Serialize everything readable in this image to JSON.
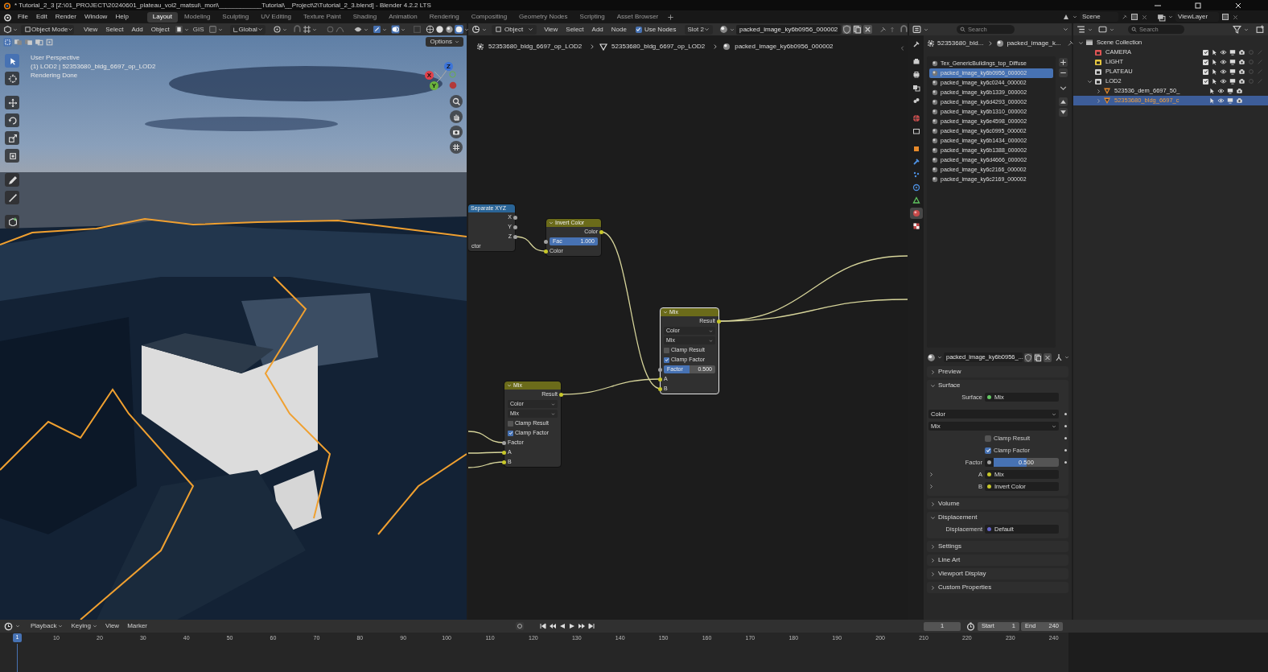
{
  "window": {
    "title": "* Tutorial_2_3 [Z:\\01_PROJECT\\20240601_plateau_vol2_matsui\\_mori\\____________Tutorial\\__Project\\2\\Tutorial_2_3.blend] - Blender 4.2.2 LTS"
  },
  "menu": [
    "File",
    "Edit",
    "Render",
    "Window",
    "Help"
  ],
  "workspaces": [
    {
      "label": "Layout",
      "selected": true
    },
    {
      "label": "Modeling",
      "selected": false
    },
    {
      "label": "Sculpting",
      "selected": false
    },
    {
      "label": "UV Editing",
      "selected": false
    },
    {
      "label": "Texture Paint",
      "selected": false
    },
    {
      "label": "Shading",
      "selected": false
    },
    {
      "label": "Animation",
      "selected": false
    },
    {
      "label": "Rendering",
      "selected": false
    },
    {
      "label": "Compositing",
      "selected": false
    },
    {
      "label": "Geometry Nodes",
      "selected": false
    },
    {
      "label": "Scripting",
      "selected": false
    },
    {
      "label": "Asset Browser",
      "selected": false
    }
  ],
  "scene": "Scene",
  "view_layer": "ViewLayer",
  "viewport": {
    "mode": "Object Mode",
    "menus": [
      "View",
      "Select",
      "Add",
      "Object"
    ],
    "gis": "GIS",
    "orientation": "Global",
    "options": "Options",
    "overlay": [
      "User Perspective",
      "(1) LOD2 | 52353680_bldg_6697_op_LOD2",
      "Rendering Done"
    ],
    "tools": [
      {
        "selected": true
      },
      {
        "selected": false
      },
      {
        "selected": false
      },
      {
        "selected": false
      },
      {
        "selected": false
      },
      {
        "selected": false
      },
      {
        "selected": false
      },
      {
        "selected": false
      },
      {
        "selected": false
      }
    ],
    "gizmo": [
      "Z",
      "X",
      "Y"
    ]
  },
  "node_editor": {
    "type": "Object",
    "menus": [
      "View",
      "Select",
      "Add",
      "Node"
    ],
    "use_nodes": {
      "label": "Use Nodes",
      "checked": true
    },
    "slot": "Slot 2",
    "material": "packed_image_ky6b0956_000002",
    "breadcrumbs": [
      "52353680_bldg_6697_op_LOD2",
      "52353680_bldg_6697_op_LOD2",
      "packed_image_ky6b0956_000002"
    ],
    "nodes": [
      {
        "title": "Separate XYZ",
        "color": "#2a6496",
        "selected": false,
        "rows": [
          {
            "kind": "output",
            "label": "X",
            "color": "#a1a1a1"
          },
          {
            "kind": "output",
            "label": "Y",
            "color": "#a1a1a1"
          },
          {
            "kind": "output",
            "label": "Z",
            "color": "#a1a1a1"
          },
          {
            "kind": "input",
            "label": "ctor"
          }
        ]
      },
      {
        "title": "Invert Color",
        "color": "#6b6b1a",
        "selected": false,
        "rows": [
          {
            "kind": "output",
            "label": "Color",
            "color": "#c7c729"
          },
          {
            "kind": "slider",
            "label": "Fac",
            "value": "1.000",
            "level": 1,
            "color": "#a1a1a1"
          },
          {
            "kind": "input",
            "label": "Color",
            "color": "#c7c729"
          }
        ]
      },
      {
        "title": "Mix",
        "color": "#6b6b1a",
        "selected": true,
        "rows": [
          {
            "kind": "output",
            "label": "Result",
            "color": "#c7c729"
          },
          {
            "kind": "dropdown",
            "label": "Color"
          },
          {
            "kind": "dropdown",
            "label": "Mix"
          },
          {
            "kind": "checkbox",
            "label": "Clamp Result",
            "checked": false
          },
          {
            "kind": "checkbox",
            "label": "Clamp Factor",
            "checked": true
          },
          {
            "kind": "slider",
            "label": "Factor",
            "value": "0.500",
            "level": 0.5,
            "color": "#a1a1a1"
          },
          {
            "kind": "input",
            "label": "A",
            "color": "#c7c729"
          },
          {
            "kind": "input",
            "label": "B",
            "color": "#c7c729"
          }
        ]
      },
      {
        "title": "Mix",
        "color": "#6b6b1a",
        "selected": false,
        "rows": [
          {
            "kind": "output",
            "label": "Result",
            "color": "#c7c729"
          },
          {
            "kind": "dropdown",
            "label": "Color"
          },
          {
            "kind": "dropdown",
            "label": "Mix"
          },
          {
            "kind": "checkbox",
            "label": "Clamp Result",
            "checked": false
          },
          {
            "kind": "checkbox",
            "label": "Clamp Factor",
            "checked": true
          },
          {
            "kind": "input",
            "label": "Factor",
            "color": "#a1a1a1"
          },
          {
            "kind": "input",
            "label": "A",
            "color": "#c7c729"
          },
          {
            "kind": "input",
            "label": "B",
            "color": "#c7c729"
          }
        ]
      }
    ]
  },
  "properties": {
    "search": {
      "placeholder": "Search"
    },
    "tabs": [
      {
        "selected": false
      },
      {
        "selected": false
      },
      {
        "selected": false
      },
      {
        "selected": false
      },
      {
        "selected": false
      },
      {
        "selected": false
      },
      {
        "selected": false
      },
      {
        "selected": false
      },
      {
        "selected": false
      },
      {
        "selected": false
      },
      {
        "selected": false
      },
      {
        "selected": false
      },
      {
        "selected": true
      },
      {
        "selected": false
      }
    ],
    "breadcrumbs": [
      "52353680_bld...",
      "packed_image_k..."
    ],
    "material_slots": [
      {
        "name": "Tex_GenericBuildings_top_Diffuse",
        "selected": false
      },
      {
        "name": "packed_image_ky6b0956_000002",
        "selected": true
      },
      {
        "name": "packed_image_ky6c0244_000002",
        "selected": false
      },
      {
        "name": "packed_image_ky6b1339_000002",
        "selected": false
      },
      {
        "name": "packed_image_ky6d4293_000002",
        "selected": false
      },
      {
        "name": "packed_image_ky6b1310_000002",
        "selected": false
      },
      {
        "name": "packed_image_ky6e4598_000002",
        "selected": false
      },
      {
        "name": "packed_image_ky6c0995_000002",
        "selected": false
      },
      {
        "name": "packed_image_ky6b1434_000002",
        "selected": false
      },
      {
        "name": "packed_image_ky6b1388_000002",
        "selected": false
      },
      {
        "name": "packed_image_ky6d4666_000002",
        "selected": false
      },
      {
        "name": "packed_image_ky6c2166_000002",
        "selected": false
      },
      {
        "name": "packed_image_ky6c2169_000002",
        "selected": false
      }
    ],
    "material_name": "packed_image_ky6b0956_...",
    "panels": [
      {
        "title": "Preview",
        "expanded": false
      },
      {
        "title": "Surface",
        "expanded": true,
        "rows": [
          {
            "kind": "link",
            "label": "Surface",
            "value": "Mix",
            "color": "#63c763",
            "expandable": false
          },
          {
            "kind": "dropdown",
            "value": "Color"
          },
          {
            "kind": "dropdown",
            "value": "Mix"
          },
          {
            "kind": "checkbox",
            "label": "Clamp Result",
            "checked": false
          },
          {
            "kind": "checkbox",
            "label": "Clamp Factor",
            "checked": true
          },
          {
            "kind": "slider",
            "label": "Factor",
            "value": "0.500",
            "level": 0.5,
            "color": "#a1a1a1"
          },
          {
            "kind": "link",
            "label": "A",
            "value": "Mix",
            "color": "#c7c729",
            "expandable": true
          },
          {
            "kind": "link",
            "label": "B",
            "value": "Invert Color",
            "color": "#c7c729",
            "expandable": true
          }
        ]
      },
      {
        "title": "Volume",
        "expanded": false
      },
      {
        "title": "Displacement",
        "expanded": true,
        "rows": [
          {
            "kind": "link",
            "label": "Displacement",
            "value": "Default",
            "color": "#6363c7",
            "expandable": false
          }
        ]
      },
      {
        "title": "Settings",
        "expanded": false
      },
      {
        "title": "Line Art",
        "expanded": false
      },
      {
        "title": "Viewport Display",
        "expanded": false
      },
      {
        "title": "Custom Properties",
        "expanded": false
      }
    ]
  },
  "outliner": {
    "search": {
      "placeholder": "Search"
    },
    "tree": [
      {
        "label": "Scene Collection",
        "kind": "scene",
        "selected": false,
        "expanded": true,
        "children": [
          {
            "label": "CAMERA",
            "kind": "collection",
            "color": "#e05555",
            "checked": true,
            "selected": false
          },
          {
            "label": "LIGHT",
            "kind": "collection",
            "color": "#e5c640",
            "checked": true,
            "selected": false
          },
          {
            "label": "PLATEAU",
            "kind": "collection",
            "color": "#d0d0d0",
            "checked": true,
            "selected": false
          },
          {
            "label": "LOD2",
            "kind": "collection",
            "color": "#d0d0d0",
            "checked": true,
            "selected": false,
            "expanded": true,
            "children": [
              {
                "label": "523536_dem_6697_50_",
                "kind": "object",
                "selected": false,
                "expanded": false
              },
              {
                "label": "52353680_bldg_6697_c",
                "kind": "object",
                "selected": true,
                "expanded": false
              }
            ]
          }
        ]
      }
    ]
  },
  "timeline": {
    "menus": [
      {
        "label": "Playback",
        "caret": true
      },
      {
        "label": "Keying",
        "caret": true
      },
      {
        "label": "View",
        "caret": false
      },
      {
        "label": "Marker",
        "caret": false
      }
    ],
    "current_frame": "1",
    "start": {
      "label": "Start",
      "value": "1"
    },
    "end": {
      "label": "End",
      "value": "240"
    },
    "playhead": "1",
    "ruler": [
      "10",
      "20",
      "30",
      "40",
      "50",
      "60",
      "70",
      "80",
      "90",
      "100",
      "110",
      "120",
      "130",
      "140",
      "150",
      "160",
      "170",
      "180",
      "190",
      "200",
      "210",
      "220",
      "230",
      "240"
    ]
  }
}
